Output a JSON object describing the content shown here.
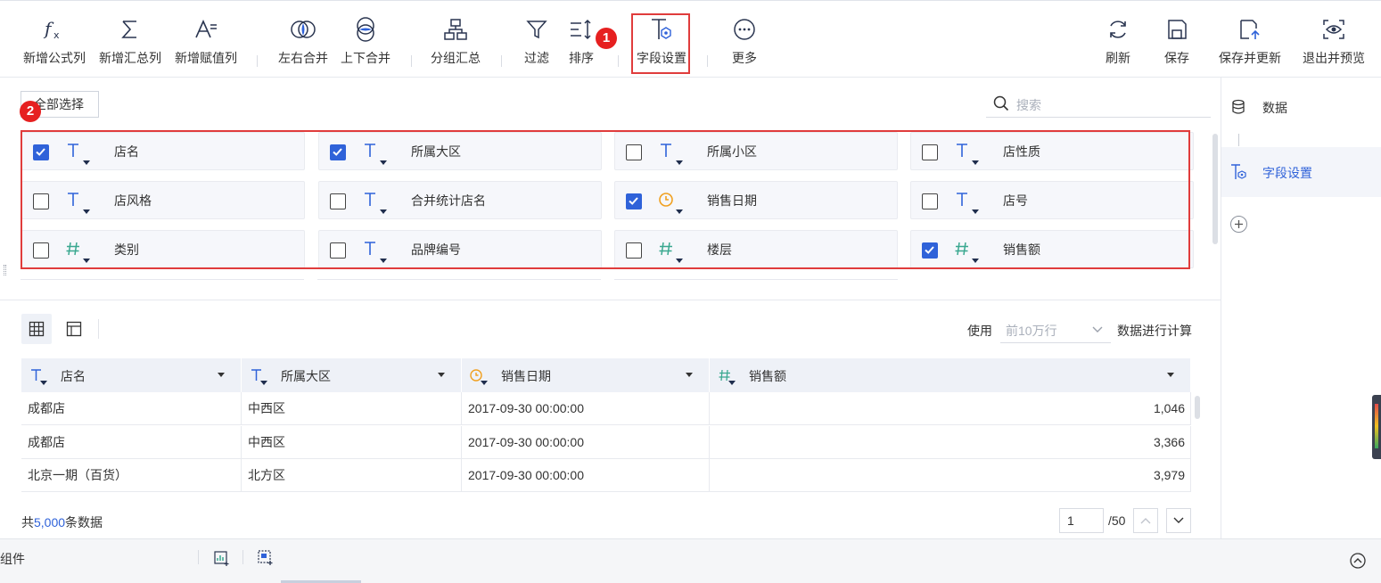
{
  "toolbar": {
    "left": [
      {
        "label": "新增公式列",
        "icon": "fx-icon"
      },
      {
        "label": "新增汇总列",
        "icon": "sigma-icon"
      },
      {
        "label": "新增赋值列",
        "icon": "assign-icon"
      },
      {
        "label": "左右合并",
        "icon": "merge-horizontal-icon"
      },
      {
        "label": "上下合并",
        "icon": "merge-vertical-icon"
      },
      {
        "label": "分组汇总",
        "icon": "group-icon"
      },
      {
        "label": "过滤",
        "icon": "filter-icon"
      },
      {
        "label": "排序",
        "icon": "sort-icon"
      },
      {
        "label": "字段设置",
        "icon": "field-settings-icon"
      },
      {
        "label": "更多",
        "icon": "more-icon"
      }
    ],
    "right": [
      {
        "label": "刷新",
        "icon": "refresh-icon"
      },
      {
        "label": "保存",
        "icon": "save-icon"
      },
      {
        "label": "保存并更新",
        "icon": "save-update-icon"
      },
      {
        "label": "退出并预览",
        "icon": "preview-icon"
      }
    ]
  },
  "badges": {
    "one": "1",
    "two": "2"
  },
  "select_all_label": "全部选择",
  "search": {
    "placeholder": "搜索"
  },
  "fields": [
    {
      "name": "店名",
      "type": "text",
      "checked": true
    },
    {
      "name": "所属大区",
      "type": "text",
      "checked": true
    },
    {
      "name": "所属小区",
      "type": "text",
      "checked": false
    },
    {
      "name": "店性质",
      "type": "text",
      "checked": false
    },
    {
      "name": "店风格",
      "type": "text",
      "checked": false
    },
    {
      "name": "合并统计店名",
      "type": "text",
      "checked": false
    },
    {
      "name": "销售日期",
      "type": "date",
      "checked": true
    },
    {
      "name": "店号",
      "type": "text",
      "checked": false
    },
    {
      "name": "类别",
      "type": "number",
      "checked": false
    },
    {
      "name": "品牌编号",
      "type": "text",
      "checked": false
    },
    {
      "name": "楼层",
      "type": "number",
      "checked": false
    },
    {
      "name": "销售额",
      "type": "number",
      "checked": true
    }
  ],
  "compute": {
    "prefix": "使用",
    "select_value": "前10万行",
    "suffix": "数据进行计算"
  },
  "table": {
    "columns": [
      {
        "name": "店名",
        "type": "text"
      },
      {
        "name": "所属大区",
        "type": "text"
      },
      {
        "name": "销售日期",
        "type": "date"
      },
      {
        "name": "销售额",
        "type": "number"
      }
    ],
    "rows": [
      [
        "成都店",
        "中西区",
        "2017-09-30 00:00:00",
        "1,046"
      ],
      [
        "成都店",
        "中西区",
        "2017-09-30 00:00:00",
        "3,366"
      ],
      [
        "北京一期（百货）",
        "北方区",
        "2017-09-30 00:00:00",
        "3,979"
      ]
    ]
  },
  "summary": {
    "prefix": "共",
    "count": "5,000",
    "suffix": "条数据"
  },
  "pagination": {
    "current": "1",
    "total": "/50"
  },
  "right_panel": {
    "items": [
      {
        "label": "数据",
        "icon": "database-icon",
        "active": false
      },
      {
        "label": "字段设置",
        "icon": "field-settings-icon",
        "active": true
      }
    ]
  },
  "bottom_bar": {
    "label": "组件"
  },
  "colors": {
    "accent": "#2f62d9",
    "text_icon": "#2f62d9",
    "date_icon": "#f0a020",
    "number_icon": "#3aa890",
    "highlight": "#e03c3c"
  }
}
